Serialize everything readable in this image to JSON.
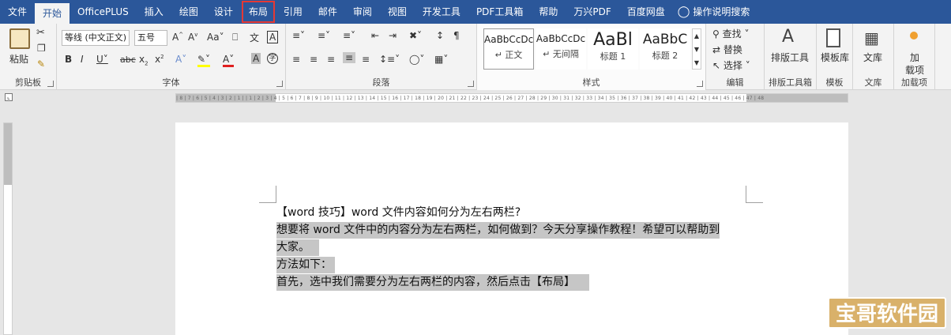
{
  "tabs": [
    "文件",
    "开始",
    "OfficePLUS",
    "插入",
    "绘图",
    "设计",
    "布局",
    "引用",
    "邮件",
    "审阅",
    "视图",
    "开发工具",
    "PDF工具箱",
    "帮助",
    "万兴PDF",
    "百度网盘"
  ],
  "tell_me": "操作说明搜索",
  "clipboard": {
    "paste": "粘贴",
    "label": "剪贴板"
  },
  "font": {
    "name": "等线 (中文正文)",
    "size": "五号",
    "label": "字体"
  },
  "paragraph": {
    "label": "段落"
  },
  "styles": {
    "items": [
      {
        "sample": "AaBbCcDc",
        "name": "↵ 正文"
      },
      {
        "sample": "AaBbCcDc",
        "name": "↵ 无间隔"
      },
      {
        "sample": "AaBl",
        "name": "标题 1"
      },
      {
        "sample": "AaBbC",
        "name": "标题 2"
      }
    ],
    "label": "样式"
  },
  "editing": {
    "find": "查找",
    "replace": "替换",
    "select": "选择",
    "label": "编辑"
  },
  "typeset": {
    "button": "排版工具",
    "label": "排版工具箱"
  },
  "template": {
    "button": "模板库",
    "label": "模板"
  },
  "library": {
    "button": "文库",
    "label": "文库"
  },
  "addins": {
    "button_line1": "加",
    "button_line2": "载项",
    "label": "加载项"
  },
  "ruler_text": "| 8 | 7 | 6 | 5 | 4 | 3 | 2 | 1 |   | 1 | 2 | 3 | 4 | 5 | 6 | 7 | 8 | 9 | 10 | 11 | 12 | 13 | 14 | 15 | 16 | 17 | 18 | 19 | 20 | 21 | 22 | 23 | 24 | 25 | 26 | 27 | 28 | 29 | 30 | 31 | 32 | 33 | 34 | 35 | 36 | 37 | 38 | 39 | 40 | 41 | 42 | 43 | 44 | 45 | 46 | 47 | 48",
  "document": {
    "lines": [
      "【word 技巧】word 文件内容如何分为左右两栏?",
      "想要将 word 文件中的内容分为左右两栏，如何做到？今天分享操作教程！希望可以帮助到",
      "大家。",
      "方法如下：",
      "首先，选中我们需要分为左右两栏的内容，然后点击【布局】"
    ]
  },
  "watermark": "宝哥软件园",
  "colors": {
    "accent": "#2b579a",
    "highlight_box": "#e53935",
    "selection": "#c6c6c6"
  }
}
